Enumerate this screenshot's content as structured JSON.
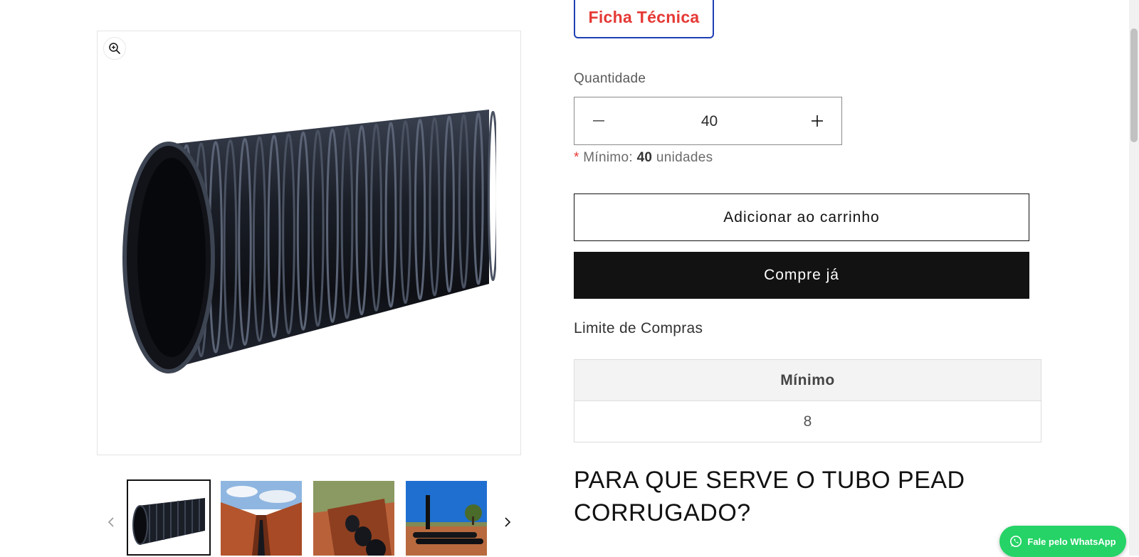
{
  "product": {
    "ficha_label": "Ficha Técnica",
    "quantity_label": "Quantidade",
    "quantity_value": "40",
    "min_note_prefix": "Mínimo:",
    "min_note_value": "40",
    "min_note_suffix": "unidades",
    "add_to_cart": "Adicionar ao carrinho",
    "buy_now": "Compre já"
  },
  "limits": {
    "title": "Limite de Compras",
    "header": "Mínimo",
    "value": "8"
  },
  "content": {
    "heading": "PARA QUE SERVE O TUBO PEAD CORRUGADO?"
  },
  "whatsapp": {
    "label": "Fale pelo WhatsApp",
    "color": "#25d366"
  },
  "colors": {
    "accent_red": "#e53935",
    "ficha_border": "#1e3fb4",
    "button_dark": "#121212"
  },
  "gallery": {
    "thumbnails": [
      "tubo-corrugado",
      "vala-tubo",
      "vala-tubos-corrugados",
      "tubo-em-campo"
    ]
  }
}
